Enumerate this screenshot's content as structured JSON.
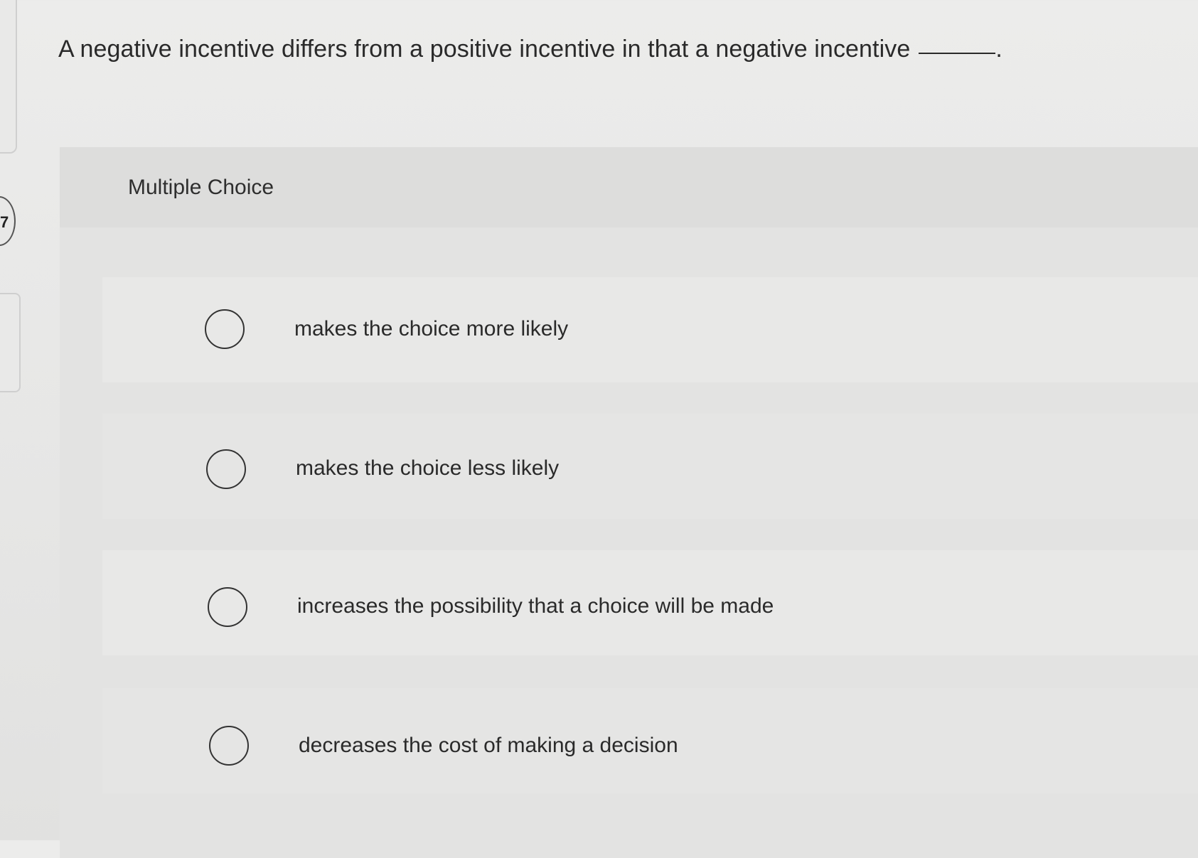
{
  "sidebar": {
    "question_number": "7"
  },
  "question": {
    "prompt": "A negative incentive differs from a positive incentive in that a negative incentive",
    "blank_suffix": "."
  },
  "multiple_choice": {
    "label": "Multiple Choice",
    "options": [
      {
        "text": "makes the choice more likely",
        "selected": false
      },
      {
        "text": "makes the choice less likely",
        "selected": false
      },
      {
        "text": "increases the possibility that a choice will be made",
        "selected": false
      },
      {
        "text": "decreases the cost of making a decision",
        "selected": false
      }
    ]
  }
}
